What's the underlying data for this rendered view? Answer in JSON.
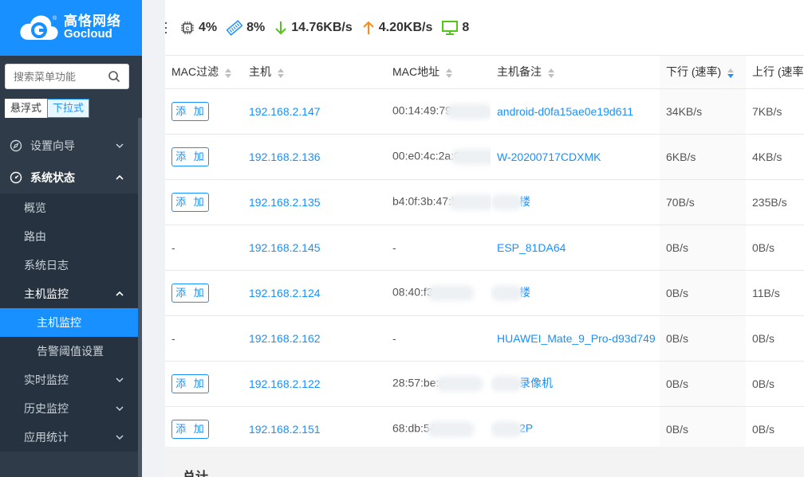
{
  "brand": {
    "cn": "高恪网络",
    "en": "Gocloud"
  },
  "sidebar": {
    "search_placeholder": "搜索菜单功能",
    "mode_float": "悬浮式",
    "mode_dropdown": "下拉式",
    "items": [
      {
        "label": "设置向导",
        "level": 0
      },
      {
        "label": "系统状态",
        "level": 0
      },
      {
        "label": "概览",
        "level": 1
      },
      {
        "label": "路由",
        "level": 1
      },
      {
        "label": "系统日志",
        "level": 1
      },
      {
        "label": "主机监控",
        "level": 1
      },
      {
        "label": "主机监控",
        "level": 2,
        "active": true
      },
      {
        "label": "告警阈值设置",
        "level": 2
      },
      {
        "label": "实时监控",
        "level": 1
      },
      {
        "label": "历史监控",
        "level": 1
      },
      {
        "label": "应用统计",
        "level": 1
      }
    ]
  },
  "topbar": {
    "cpu": "4%",
    "mem": "8%",
    "down_rate": "14.76KB/s",
    "up_rate": "4.20KB/s",
    "hosts": "8",
    "colors": {
      "down": "#52c41a",
      "up": "#fa8c16",
      "host": "#52c41a"
    }
  },
  "table": {
    "headers": [
      "MAC过滤",
      "主机",
      "MAC地址",
      "主机备注",
      "下行 (速率)",
      "上行 (速率"
    ],
    "add_label": "添 加",
    "rows": [
      {
        "filter": "add",
        "host": "192.168.2.147",
        "mac": "00:14:49:79:",
        "note": "android-d0fa15ae0e19d611",
        "down": "34KB/s",
        "up": "7KB/s"
      },
      {
        "filter": "add",
        "host": "192.168.2.136",
        "mac": "00:e0:4c:2a:0",
        "note": "W-20200717CDXMK",
        "down": "6KB/s",
        "up": "4KB/s"
      },
      {
        "filter": "add",
        "host": "192.168.2.135",
        "mac": "b4:0f:3b:47:b",
        "note": "楼",
        "down": "70B/s",
        "up": "235B/s"
      },
      {
        "filter": "-",
        "host": "192.168.2.145",
        "mac": "-",
        "note": "ESP_81DA64",
        "down": "0B/s",
        "up": "0B/s"
      },
      {
        "filter": "add",
        "host": "192.168.2.124",
        "mac": "08:40:f3:",
        "note": "楼",
        "down": "0B/s",
        "up": "11B/s"
      },
      {
        "filter": "-",
        "host": "192.168.2.162",
        "mac": "-",
        "note": "HUAWEI_Mate_9_Pro-d93d749",
        "down": "0B/s",
        "up": "0B/s"
      },
      {
        "filter": "add",
        "host": "192.168.2.122",
        "mac": "28:57:be:a",
        "note": "录像机",
        "down": "0B/s",
        "up": "0B/s"
      },
      {
        "filter": "add",
        "host": "192.168.2.151",
        "mac": "68:db:54",
        "note": "2P",
        "down": "0B/s",
        "up": "0B/s"
      }
    ],
    "total_label": "总计"
  }
}
